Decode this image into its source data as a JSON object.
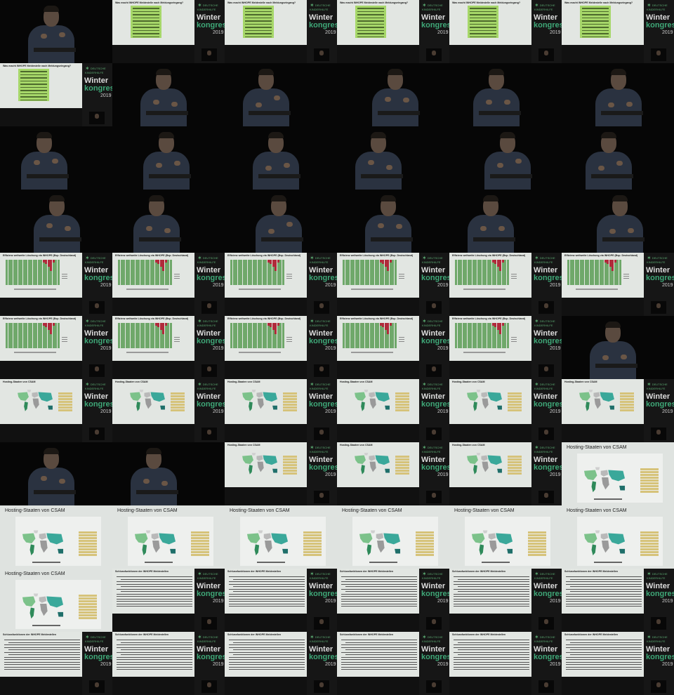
{
  "slides": {
    "weldestelle_title": "Was macht INHOPE Meldestelle nach Meldungseingang?",
    "loeschung_title": "Effizienz weltweite Löschung via INHOPE (Bsp. Deutschland)",
    "hosting_title": "Hosting-Staaten von CSAM",
    "schluss_title": "Schlussfunktionen der INHOPE Meldestellen"
  },
  "branding": {
    "logo_text": "DEUTSCHE KINDERHILFE",
    "line1": "Winter",
    "line2": "kongress",
    "year": "2019"
  },
  "grid": {
    "columns": 6,
    "rows": 11,
    "tiles": [
      "speaker",
      "weldestelle",
      "weldestelle",
      "weldestelle",
      "weldestelle",
      "weldestelle",
      "weldestelle",
      "speaker",
      "speaker",
      "speaker",
      "speaker",
      "speaker",
      "speaker",
      "speaker",
      "speaker",
      "speaker",
      "speaker",
      "speaker",
      "speaker",
      "speaker",
      "speaker",
      "speaker",
      "speaker",
      "speaker",
      "loeschung",
      "loeschung",
      "loeschung",
      "loeschung",
      "loeschung",
      "loeschung",
      "loeschung",
      "loeschung",
      "loeschung",
      "loeschung",
      "loeschung",
      "speaker",
      "hosting",
      "hosting",
      "hosting",
      "hosting",
      "hosting",
      "hosting",
      "speaker",
      "speaker",
      "hosting",
      "hosting",
      "hosting",
      "hosting_full",
      "hosting_full",
      "hosting_full",
      "hosting_full",
      "hosting_full",
      "hosting_full",
      "hosting_full",
      "hosting_full",
      "schluss",
      "schluss",
      "schluss",
      "schluss",
      "schluss",
      "schluss",
      "schluss",
      "schluss",
      "schluss",
      "schluss",
      "schluss"
    ]
  },
  "colors": {
    "slide_bg": "#e2e6e2",
    "sidebar_bg": "#161616",
    "brand_green": "#3fa878",
    "callout_green": "#a6d769",
    "bar_green": "#6fa86a",
    "bar_red": "#b02a3a"
  }
}
